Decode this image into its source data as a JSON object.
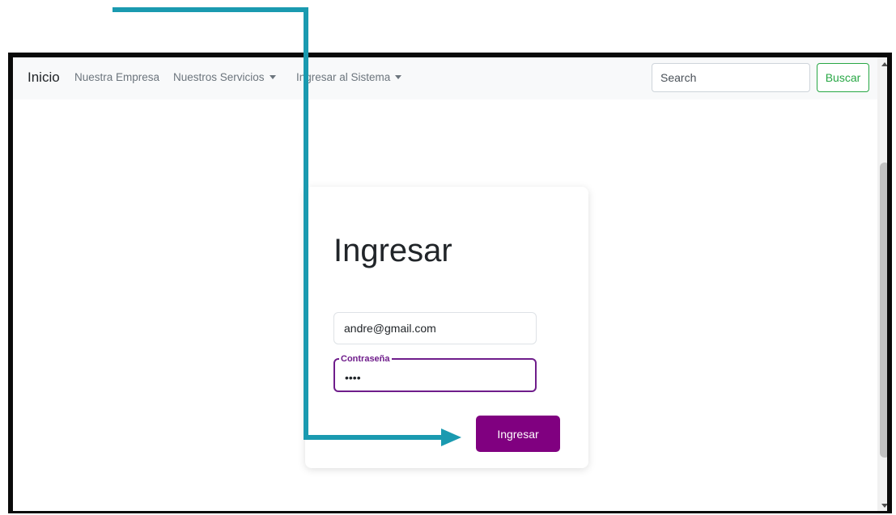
{
  "navbar": {
    "brand": "Inicio",
    "links": [
      {
        "label": "Nuestra Empresa",
        "dropdown": false
      },
      {
        "label": "Nuestros Servicios",
        "dropdown": true
      },
      {
        "label": "Ingresar al Sistema",
        "dropdown": true
      }
    ],
    "search": {
      "placeholder": "Search",
      "value": ""
    },
    "search_button": "Buscar"
  },
  "login": {
    "title": "Ingresar",
    "email": {
      "value": "andre@gmail.com"
    },
    "password": {
      "label": "Contraseña",
      "value": "1234"
    },
    "submit_label": "Ingresar"
  },
  "colors": {
    "accent": "#800080",
    "focus_border": "#6f1d8b",
    "search_button": "#28a745",
    "annotation_arrow": "#1a9ab0"
  },
  "icons": [
    "caret-down-icon",
    "arrow-right-icon",
    "scroll-up-icon",
    "scroll-down-icon"
  ]
}
